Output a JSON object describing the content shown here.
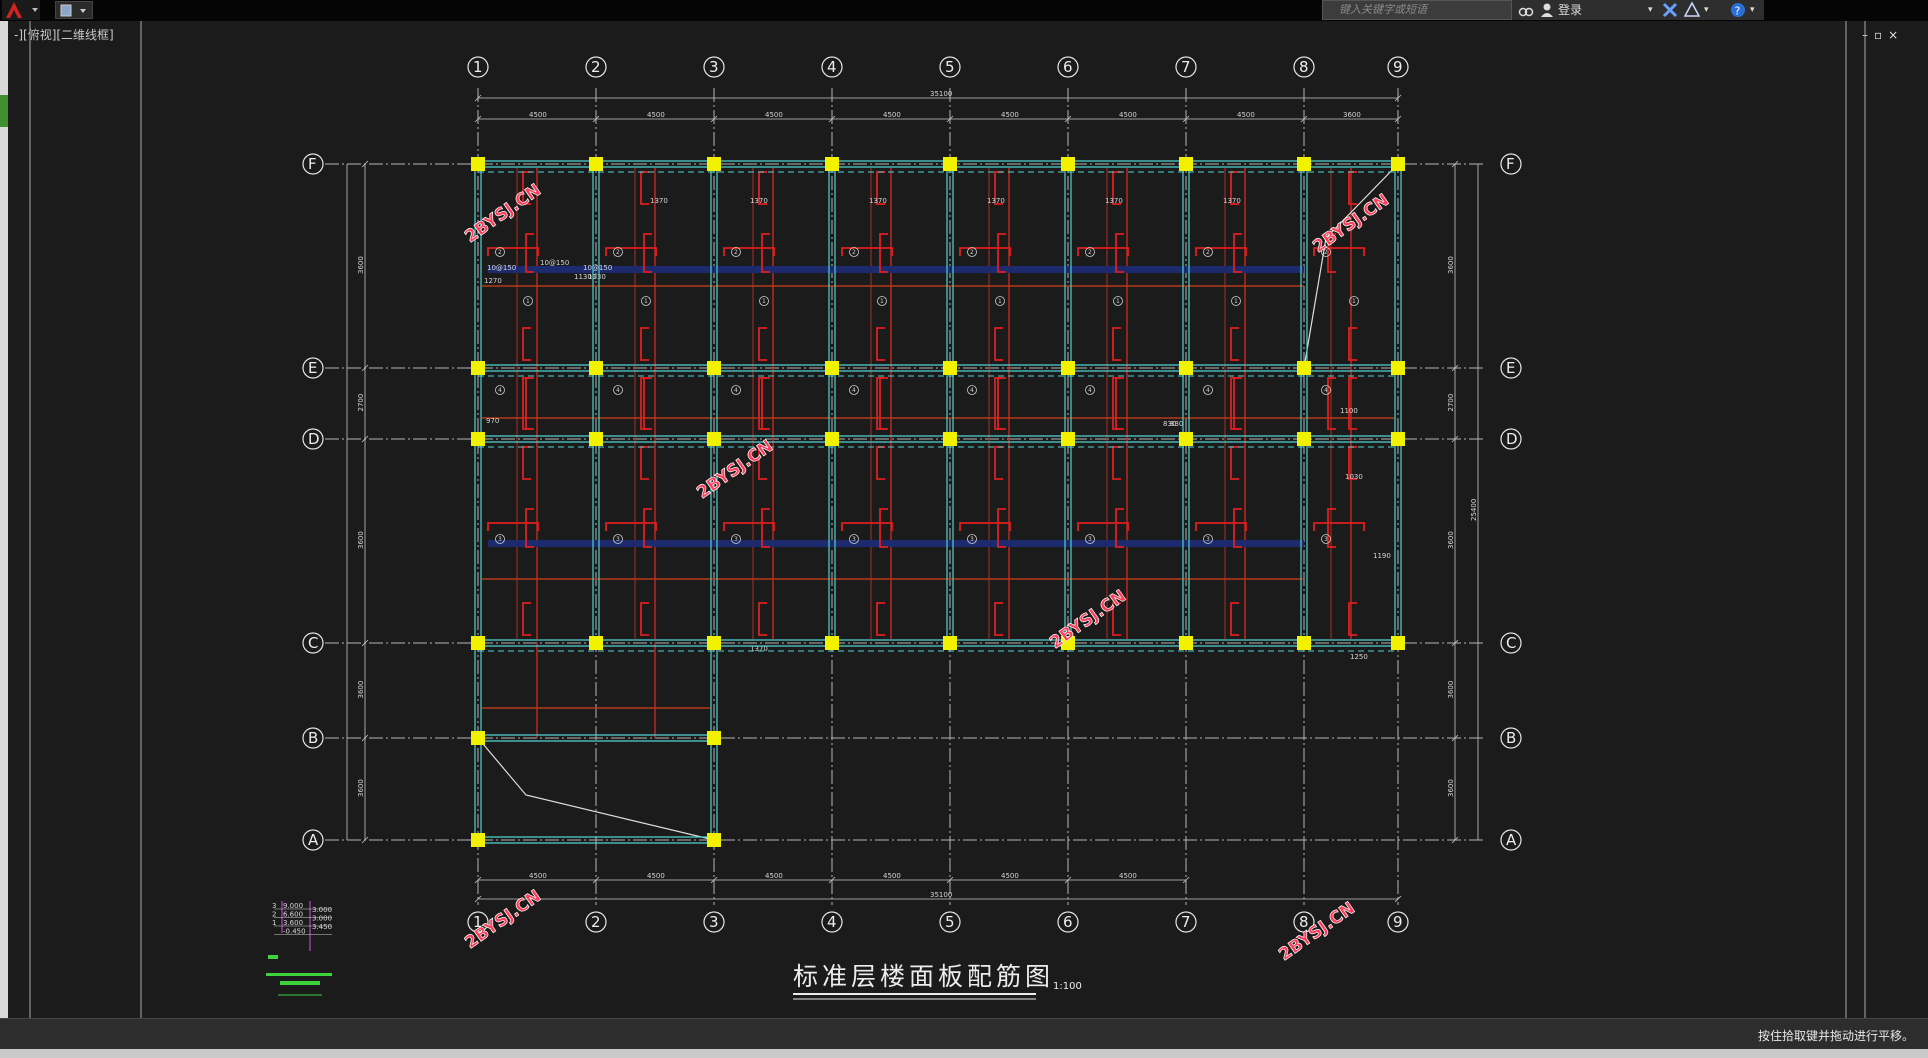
{
  "toolbar": {
    "search_placeholder": "键入关键字或短语",
    "login_label": "登录"
  },
  "view": {
    "label": "-][俯视][二维线框]"
  },
  "status": {
    "message": "按住拾取键并拖动进行平移。"
  },
  "drawing": {
    "title": "标准层楼面板配筋图",
    "scale": "1:100",
    "grid_columns": [
      "1",
      "2",
      "3",
      "4",
      "5",
      "6",
      "7",
      "8",
      "9"
    ],
    "grid_rows": [
      "F",
      "E",
      "D",
      "C",
      "B",
      "A"
    ],
    "dims_top": [
      "4500",
      "4500",
      "4500",
      "4500",
      "4500",
      "4500",
      "4500",
      "3600"
    ],
    "dims_bottom": [
      "4500",
      "4500",
      "4500",
      "4500",
      "4500",
      "4500"
    ],
    "dim_total": "35100",
    "dims_left": [
      "3600",
      "2700",
      "3600",
      "3600",
      "3600"
    ],
    "dims_right": [
      "3600",
      "2700",
      "3600",
      "3600",
      "3600"
    ],
    "dim_right_total": "25400",
    "rebar_notes": [
      "10@150",
      "1370",
      "1270",
      "1130",
      "970",
      "830",
      "1190",
      "1100",
      "1030",
      "1250"
    ],
    "watermark": "2BYSJ.CN",
    "legend": {
      "levels": [
        "9.000",
        "6.600",
        "3.600",
        "-0.450"
      ],
      "heights": [
        "3.000",
        "3.000",
        "3.450"
      ],
      "floor_nums": [
        "3",
        "2",
        "1"
      ]
    }
  },
  "colors": {
    "column": "#f2f200",
    "beam": "#4fd2d2",
    "rebar": "#e01e1e",
    "slab_neg": "#b83a1a",
    "dim": "#c8c8c8",
    "bg": "#1b1b1b"
  }
}
